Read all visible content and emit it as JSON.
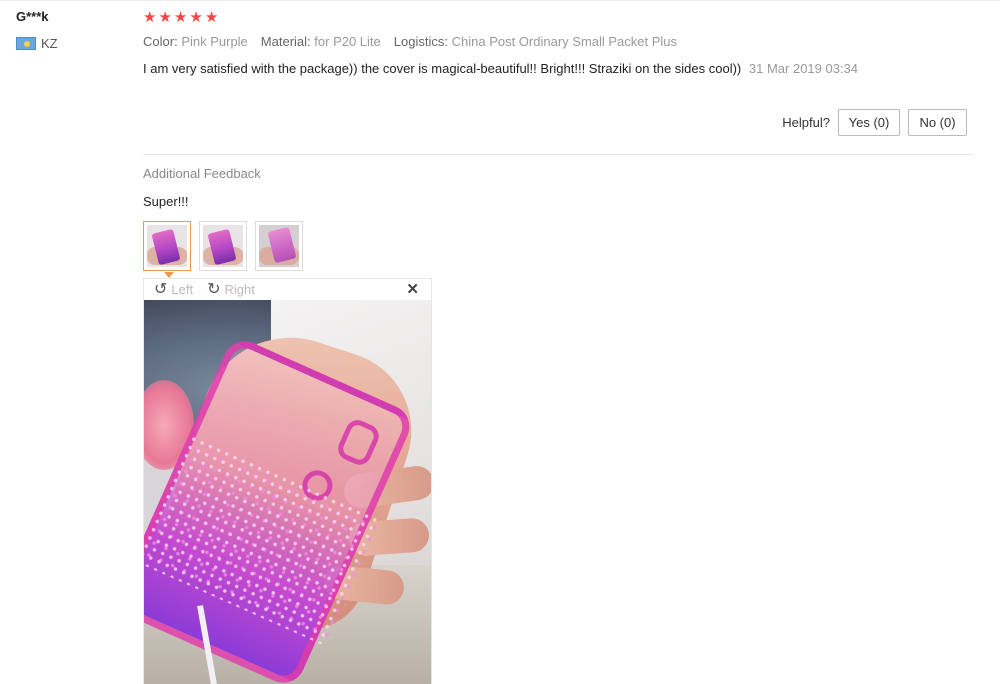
{
  "reviewer": {
    "name": "G***k",
    "country_code": "KZ",
    "flag_icon": "kazakhstan-flag-icon"
  },
  "rating": {
    "stars": 5,
    "max": 5,
    "star_color": "#f44444"
  },
  "attributes": [
    {
      "key": "Color:",
      "value": "Pink Purple"
    },
    {
      "key": "Material:",
      "value": "for P20 Lite"
    },
    {
      "key": "Logistics:",
      "value": "China Post Ordinary Small Packet Plus"
    }
  ],
  "review": {
    "text": "I am very satisfied with the package)) the cover is magical-beautiful!! Bright!!! Straziki on the sides cool))",
    "date": "31 Mar 2019 03:34"
  },
  "helpful": {
    "label": "Helpful?",
    "yes_label": "Yes (0)",
    "no_label": "No (0)"
  },
  "additional_feedback": {
    "title": "Additional Feedback",
    "text": "Super!!!"
  },
  "thumbnails": [
    {
      "name": "photo-1",
      "selected": true
    },
    {
      "name": "photo-2",
      "selected": false
    },
    {
      "name": "photo-3",
      "selected": false
    }
  ],
  "viewer": {
    "rotate_left_label": "Left",
    "rotate_right_label": "Right",
    "rotate_left_icon": "rotate-left-icon",
    "rotate_right_icon": "rotate-right-icon",
    "close_icon": "close-icon"
  },
  "colors": {
    "accent_border": "#e99a4e",
    "muted_text": "#999999"
  }
}
